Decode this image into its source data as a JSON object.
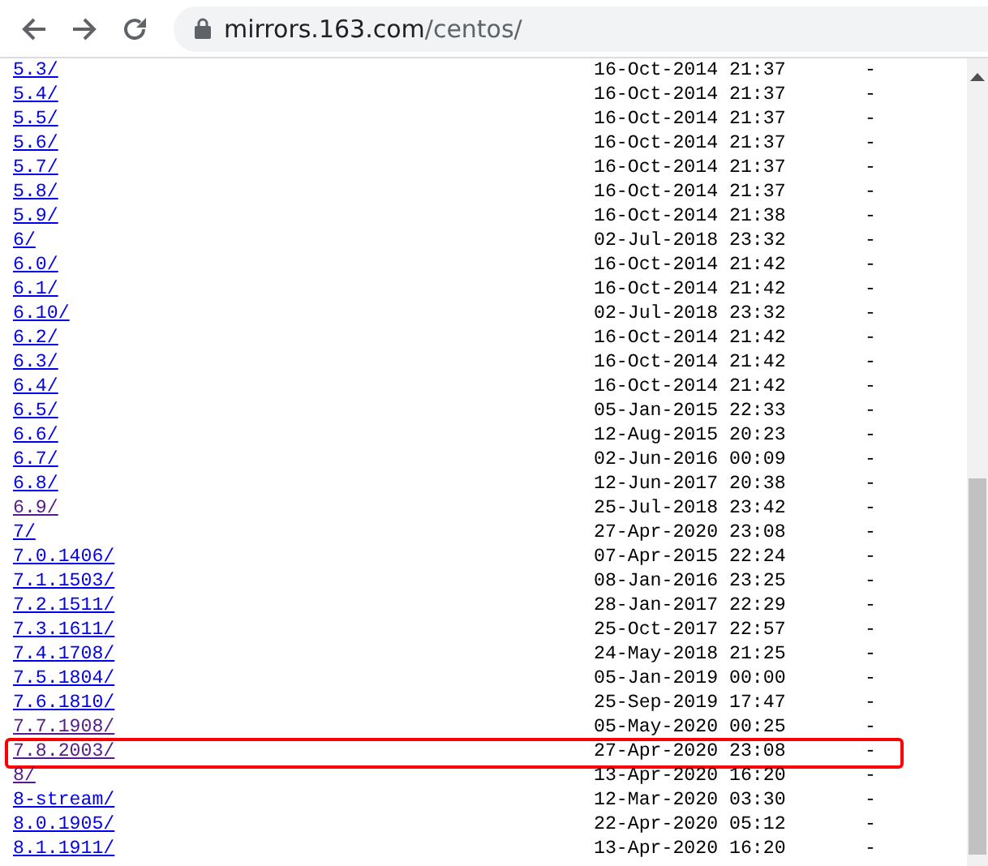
{
  "toolbar": {
    "address": {
      "host": "mirrors.163.com",
      "path": "/centos/"
    }
  },
  "listing": {
    "rows": [
      {
        "name": "5.3/",
        "modified": "16-Oct-2014 21:37",
        "size": "-",
        "visited": false,
        "highlighted": false
      },
      {
        "name": "5.4/",
        "modified": "16-Oct-2014 21:37",
        "size": "-",
        "visited": false,
        "highlighted": false
      },
      {
        "name": "5.5/",
        "modified": "16-Oct-2014 21:37",
        "size": "-",
        "visited": false,
        "highlighted": false
      },
      {
        "name": "5.6/",
        "modified": "16-Oct-2014 21:37",
        "size": "-",
        "visited": false,
        "highlighted": false
      },
      {
        "name": "5.7/",
        "modified": "16-Oct-2014 21:37",
        "size": "-",
        "visited": false,
        "highlighted": false
      },
      {
        "name": "5.8/",
        "modified": "16-Oct-2014 21:37",
        "size": "-",
        "visited": false,
        "highlighted": false
      },
      {
        "name": "5.9/",
        "modified": "16-Oct-2014 21:38",
        "size": "-",
        "visited": false,
        "highlighted": false
      },
      {
        "name": "6/",
        "modified": "02-Jul-2018 23:32",
        "size": "-",
        "visited": false,
        "highlighted": false
      },
      {
        "name": "6.0/",
        "modified": "16-Oct-2014 21:42",
        "size": "-",
        "visited": false,
        "highlighted": false
      },
      {
        "name": "6.1/",
        "modified": "16-Oct-2014 21:42",
        "size": "-",
        "visited": false,
        "highlighted": false
      },
      {
        "name": "6.10/",
        "modified": "02-Jul-2018 23:32",
        "size": "-",
        "visited": false,
        "highlighted": false
      },
      {
        "name": "6.2/",
        "modified": "16-Oct-2014 21:42",
        "size": "-",
        "visited": false,
        "highlighted": false
      },
      {
        "name": "6.3/",
        "modified": "16-Oct-2014 21:42",
        "size": "-",
        "visited": false,
        "highlighted": false
      },
      {
        "name": "6.4/",
        "modified": "16-Oct-2014 21:42",
        "size": "-",
        "visited": false,
        "highlighted": false
      },
      {
        "name": "6.5/",
        "modified": "05-Jan-2015 22:33",
        "size": "-",
        "visited": false,
        "highlighted": false
      },
      {
        "name": "6.6/",
        "modified": "12-Aug-2015 20:23",
        "size": "-",
        "visited": false,
        "highlighted": false
      },
      {
        "name": "6.7/",
        "modified": "02-Jun-2016 00:09",
        "size": "-",
        "visited": false,
        "highlighted": false
      },
      {
        "name": "6.8/",
        "modified": "12-Jun-2017 20:38",
        "size": "-",
        "visited": false,
        "highlighted": false
      },
      {
        "name": "6.9/",
        "modified": "25-Jul-2018 23:42",
        "size": "-",
        "visited": true,
        "highlighted": false
      },
      {
        "name": "7/",
        "modified": "27-Apr-2020 23:08",
        "size": "-",
        "visited": false,
        "highlighted": false
      },
      {
        "name": "7.0.1406/",
        "modified": "07-Apr-2015 22:24",
        "size": "-",
        "visited": false,
        "highlighted": false
      },
      {
        "name": "7.1.1503/",
        "modified": "08-Jan-2016 23:25",
        "size": "-",
        "visited": false,
        "highlighted": false
      },
      {
        "name": "7.2.1511/",
        "modified": "28-Jan-2017 22:29",
        "size": "-",
        "visited": false,
        "highlighted": false
      },
      {
        "name": "7.3.1611/",
        "modified": "25-Oct-2017 22:57",
        "size": "-",
        "visited": false,
        "highlighted": false
      },
      {
        "name": "7.4.1708/",
        "modified": "24-May-2018 21:25",
        "size": "-",
        "visited": false,
        "highlighted": false
      },
      {
        "name": "7.5.1804/",
        "modified": "05-Jan-2019 00:00",
        "size": "-",
        "visited": false,
        "highlighted": false
      },
      {
        "name": "7.6.1810/",
        "modified": "25-Sep-2019 17:47",
        "size": "-",
        "visited": false,
        "highlighted": false
      },
      {
        "name": "7.7.1908/",
        "modified": "05-May-2020 00:25",
        "size": "-",
        "visited": true,
        "highlighted": false
      },
      {
        "name": "7.8.2003/",
        "modified": "27-Apr-2020 23:08",
        "size": "-",
        "visited": true,
        "highlighted": true
      },
      {
        "name": "8/",
        "modified": "13-Apr-2020 16:20",
        "size": "-",
        "visited": true,
        "highlighted": false
      },
      {
        "name": "8-stream/",
        "modified": "12-Mar-2020 03:30",
        "size": "-",
        "visited": false,
        "highlighted": false
      },
      {
        "name": "8.0.1905/",
        "modified": "22-Apr-2020 05:12",
        "size": "-",
        "visited": false,
        "highlighted": false
      },
      {
        "name": "8.1.1911/",
        "modified": "13-Apr-2020 16:20",
        "size": "-",
        "visited": false,
        "highlighted": false
      }
    ]
  }
}
